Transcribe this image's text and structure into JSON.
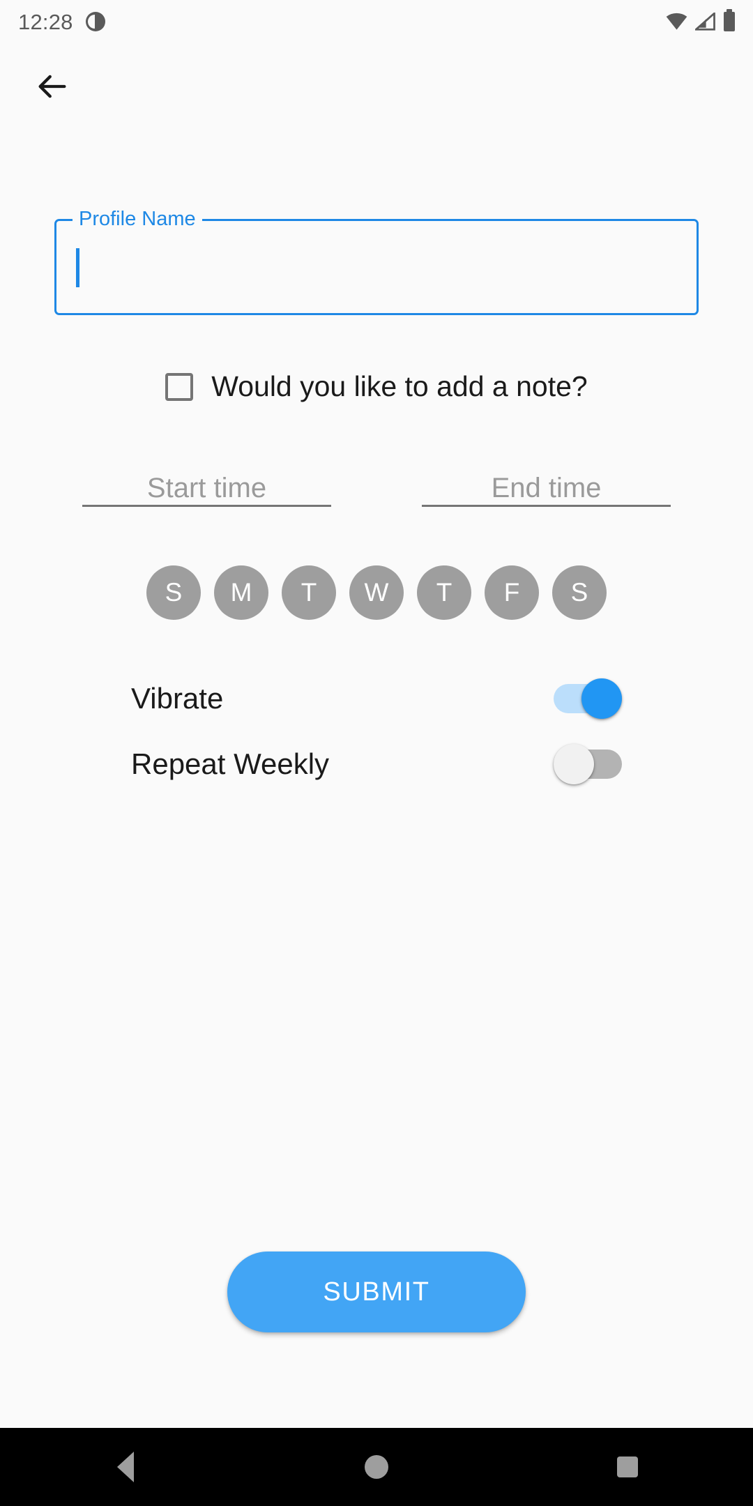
{
  "status_bar": {
    "time": "12:28",
    "icons": [
      "do-not-disturb-icon",
      "wifi-icon",
      "signal-icon",
      "battery-icon"
    ]
  },
  "app_bar": {
    "back_icon": "arrow-left-icon"
  },
  "form": {
    "profile_name": {
      "label": "Profile Name",
      "value": "",
      "placeholder": ""
    },
    "note_checkbox": {
      "label": "Would you like to add a note?",
      "checked": false
    },
    "start_time": {
      "placeholder": "Start time",
      "value": ""
    },
    "end_time": {
      "placeholder": "End time",
      "value": ""
    },
    "days": [
      {
        "label": "S",
        "name": "sunday",
        "selected": false
      },
      {
        "label": "M",
        "name": "monday",
        "selected": false
      },
      {
        "label": "T",
        "name": "tuesday",
        "selected": false
      },
      {
        "label": "W",
        "name": "wednesday",
        "selected": false
      },
      {
        "label": "T",
        "name": "thursday",
        "selected": false
      },
      {
        "label": "F",
        "name": "friday",
        "selected": false
      },
      {
        "label": "S",
        "name": "saturday",
        "selected": false
      }
    ],
    "vibrate": {
      "label": "Vibrate",
      "on": true
    },
    "repeat_weekly": {
      "label": "Repeat Weekly",
      "on": false
    },
    "submit_label": "SUBMIT"
  },
  "nav_bar": {
    "back": "nav-back-icon",
    "home": "nav-home-icon",
    "recents": "nav-recents-icon"
  },
  "colors": {
    "accent": "#42a5f5",
    "field_outline": "#1e88e5",
    "label_blue": "#1e88e5",
    "background": "#fafafa",
    "day_circle": "#9e9e9e",
    "text_primary": "#1a1a1a",
    "text_muted": "#9a9a9a",
    "nav_background": "#000000"
  }
}
